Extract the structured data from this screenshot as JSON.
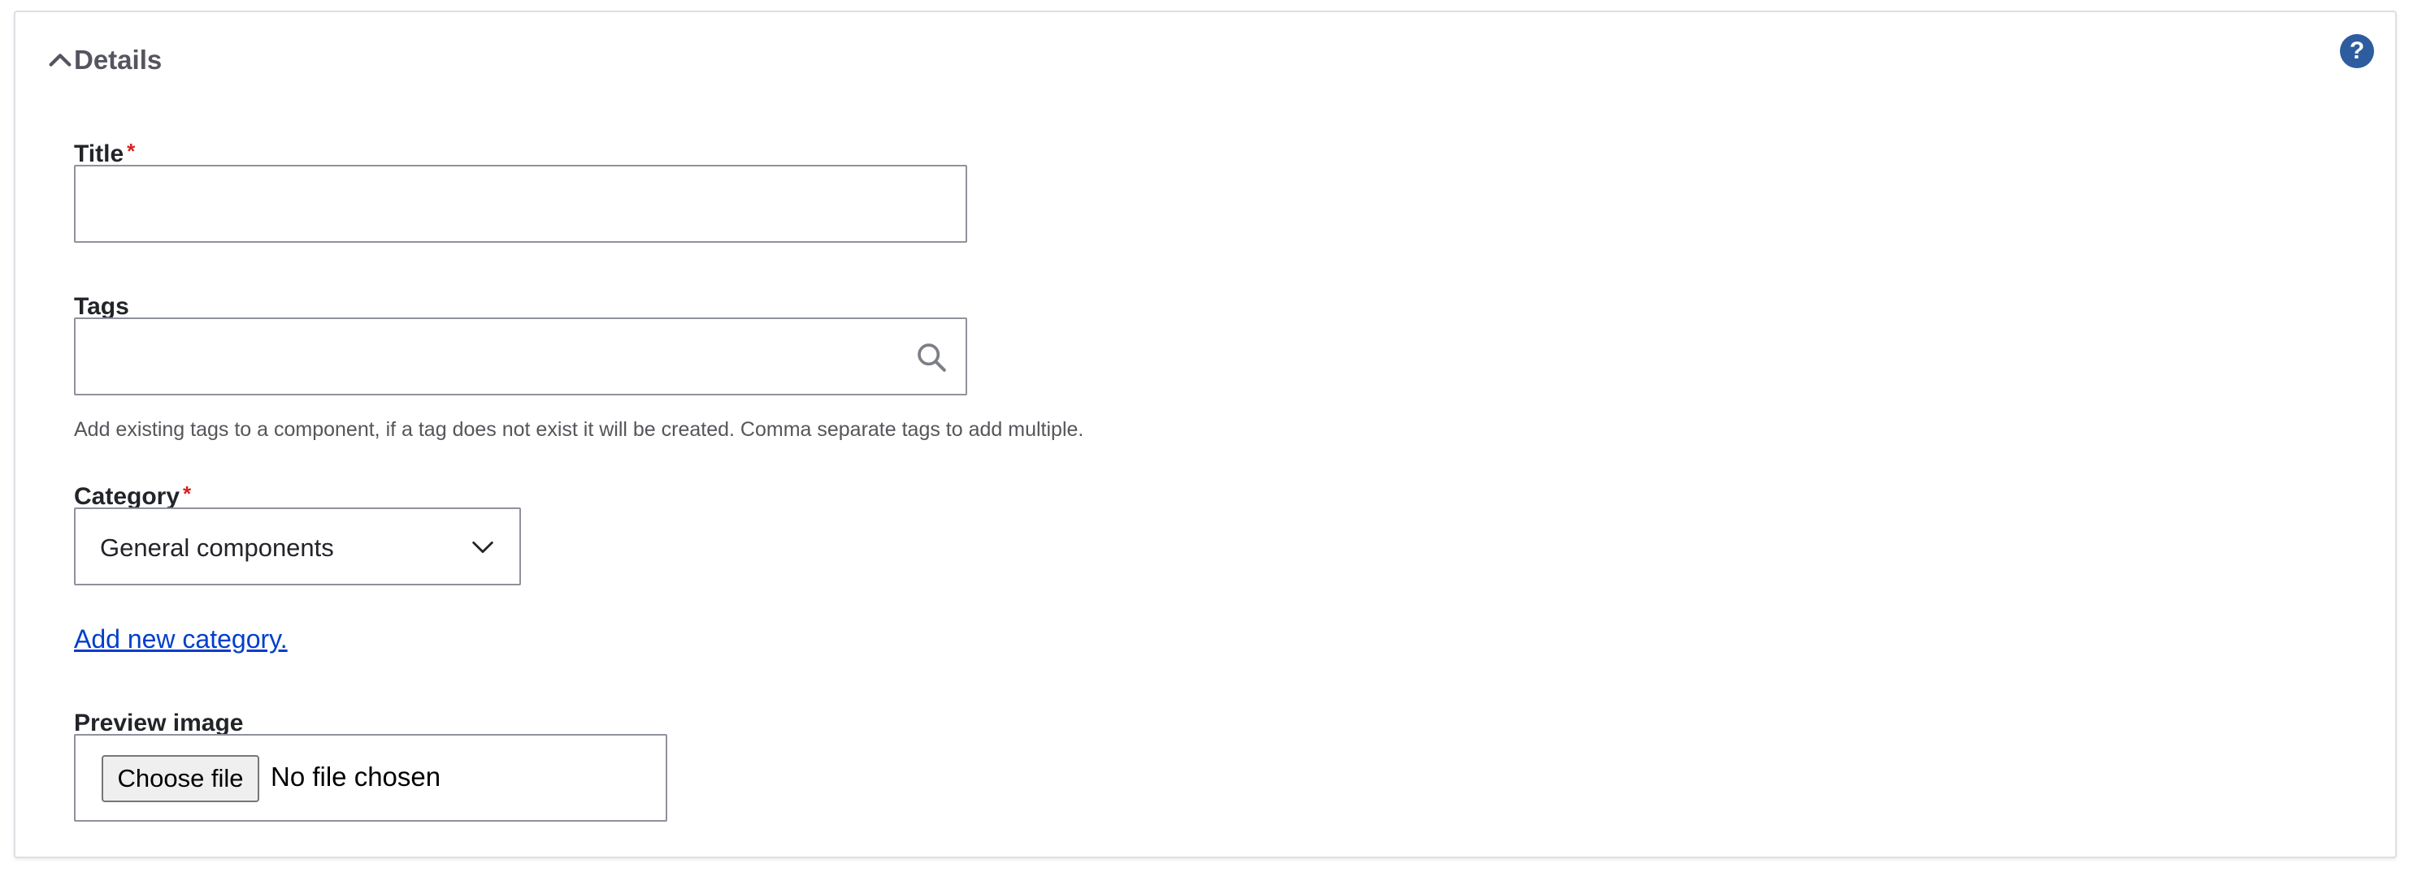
{
  "details": {
    "summary_title": "Details",
    "help_icon_glyph": "?",
    "accent_color": "#2d5d9e"
  },
  "fields": {
    "title": {
      "label": "Title",
      "required_mark": "*",
      "value": ""
    },
    "tags": {
      "label": "Tags",
      "value": "",
      "description": "Add existing tags to a component, if a tag does not exist it will be created. Comma separate tags to add multiple."
    },
    "category": {
      "label": "Category",
      "required_mark": "*",
      "selected": "General components"
    },
    "add_category_link": "Add new category.",
    "preview_image": {
      "label": "Preview image",
      "button_label": "Choose file",
      "status": "No file chosen"
    }
  },
  "colors": {
    "required": "#d72222",
    "link": "#003ecc"
  }
}
